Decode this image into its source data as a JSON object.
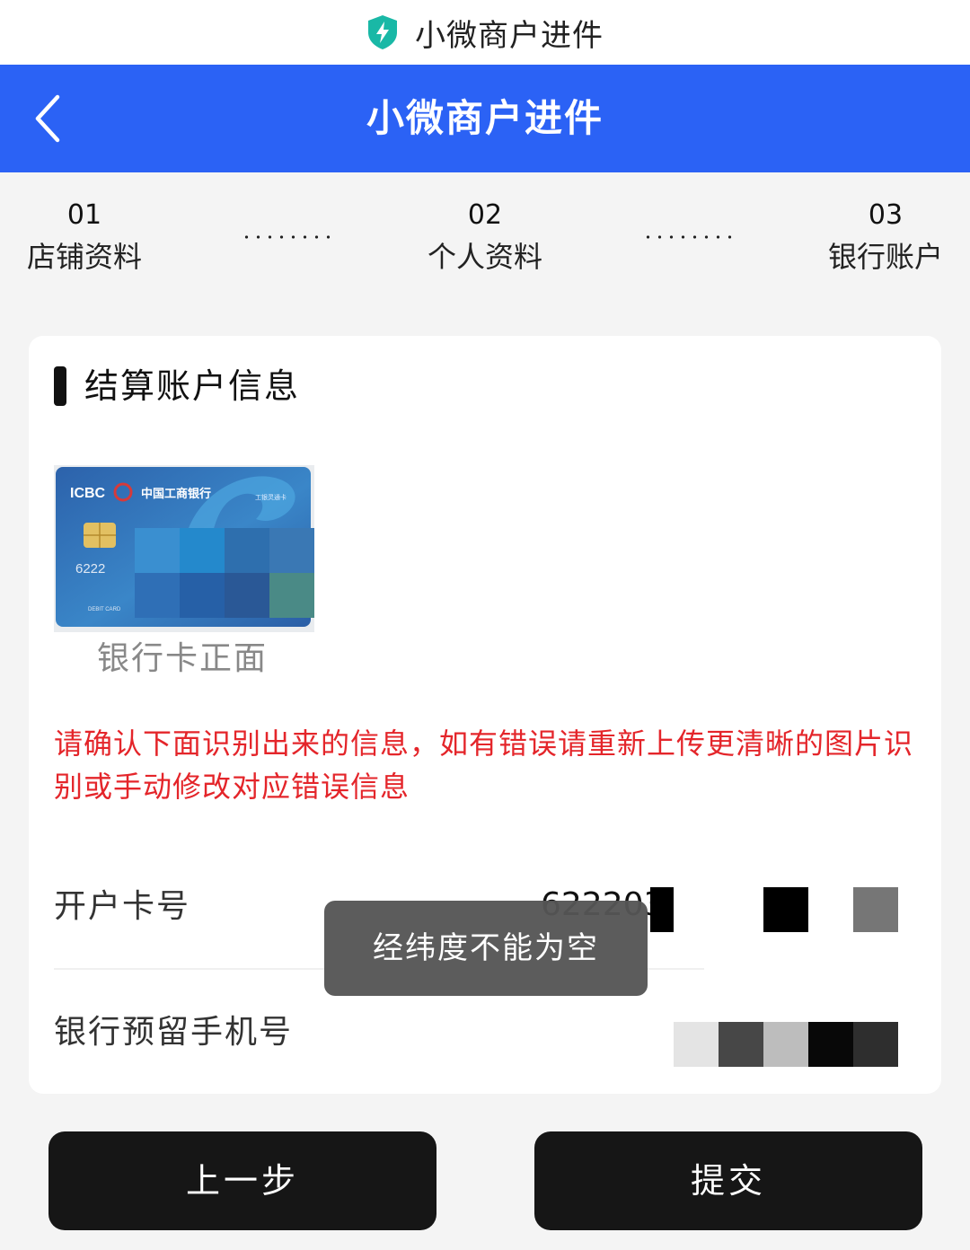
{
  "titlebar": {
    "title": "小微商户进件",
    "icon": "shield-lightning-icon"
  },
  "navbar": {
    "title": "小微商户进件",
    "back_icon": "chevron-left-icon"
  },
  "steps": [
    {
      "num": "01",
      "label": "店铺资料"
    },
    {
      "num": "02",
      "label": "个人资料"
    },
    {
      "num": "03",
      "label": "银行账户"
    }
  ],
  "section": {
    "title": "结算账户信息"
  },
  "upload": {
    "label": "银行卡正面",
    "card_brand": "ICBC",
    "card_bank": "中国工商银行",
    "card_type": "工银灵通卡",
    "card_debit": "DEBIT CARD",
    "card_number_partial": "6222"
  },
  "warning": "请确认下面识别出来的信息，如有错误请重新上传更清晰的图片识别或手动修改对应错误信息",
  "fields": {
    "card_number": {
      "label": "开户卡号",
      "value": "622203"
    },
    "phone": {
      "label": "银行预留手机号",
      "value": ""
    }
  },
  "toast": "经纬度不能为空",
  "buttons": {
    "prev": "上一步",
    "submit": "提交"
  },
  "colors": {
    "primary": "#2b62f5",
    "warning": "#e4252a",
    "button": "#161616",
    "shield": "#19b8a6"
  }
}
